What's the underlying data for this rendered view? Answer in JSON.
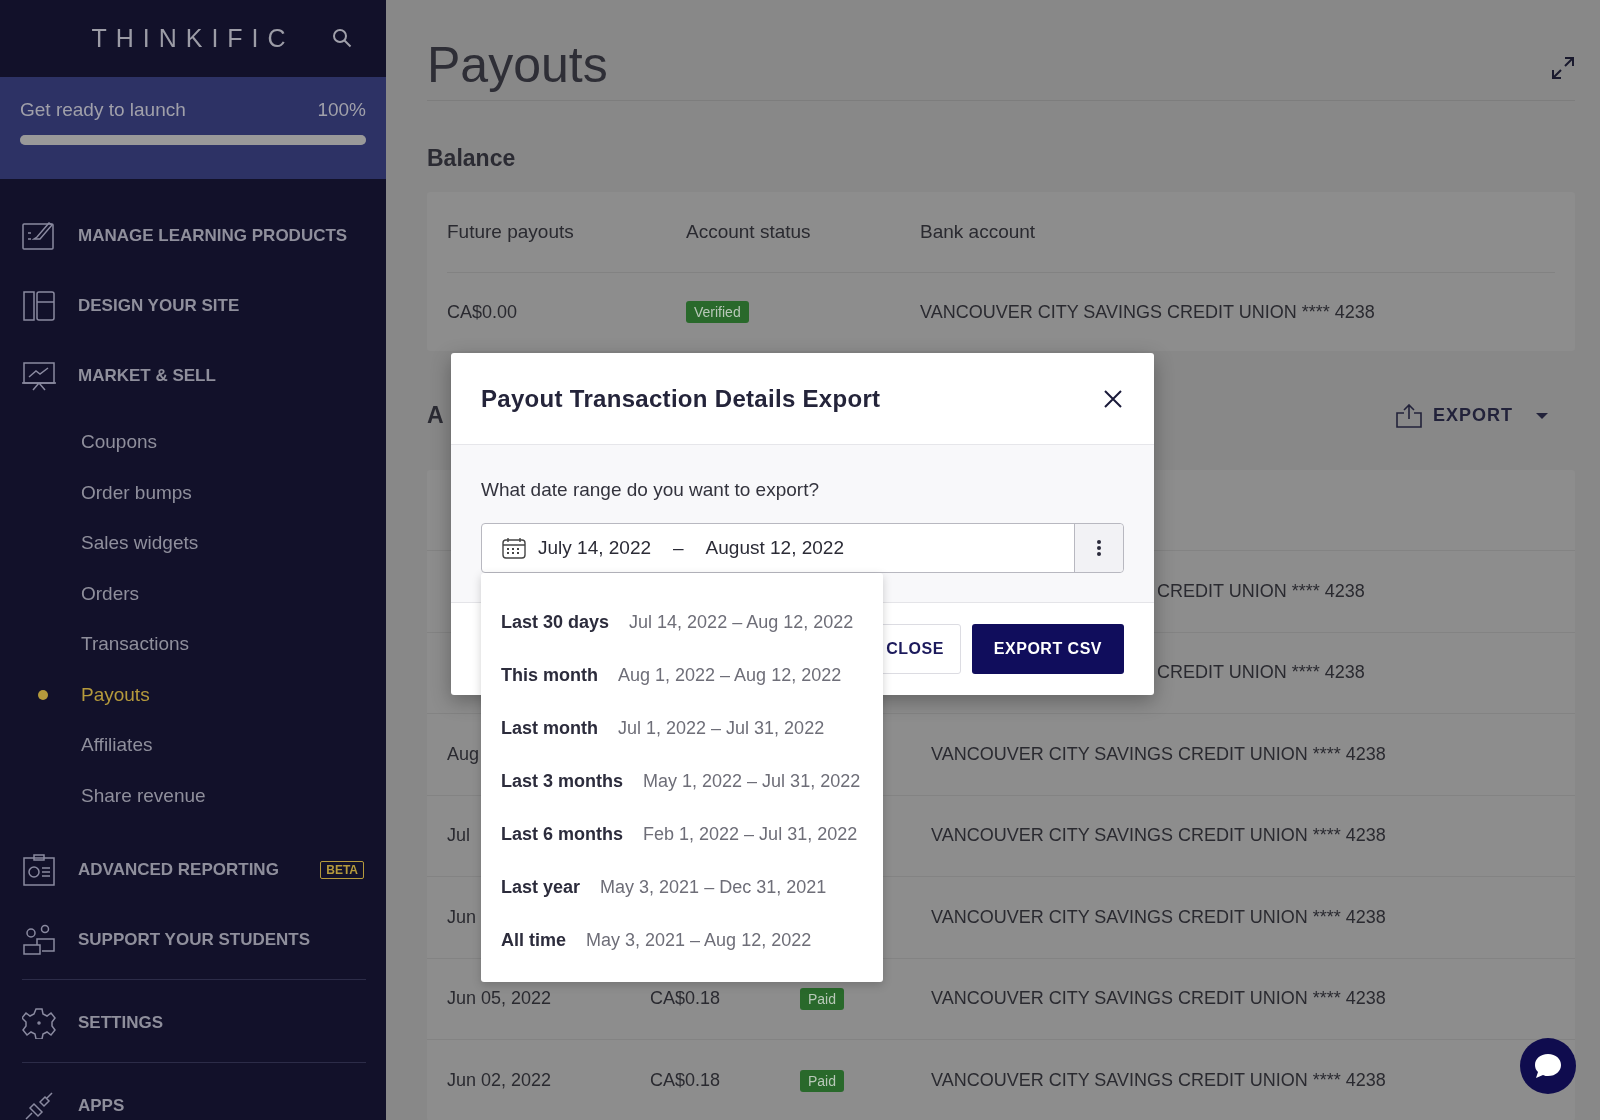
{
  "sidebar": {
    "logo": "THINKIFIC",
    "launch": {
      "label": "Get ready to launch",
      "percent": "100%",
      "level": 1
    },
    "sections": [
      {
        "label": "MANAGE LEARNING PRODUCTS",
        "divider_before": false
      },
      {
        "label": "DESIGN YOUR SITE",
        "divider_before": false
      },
      {
        "label": "MARKET & SELL",
        "divider_before": false,
        "children": [
          {
            "label": "Coupons",
            "selected": false
          },
          {
            "label": "Order bumps",
            "selected": false
          },
          {
            "label": "Sales widgets",
            "selected": false
          },
          {
            "label": "Orders",
            "selected": false
          },
          {
            "label": "Transactions",
            "selected": false
          },
          {
            "label": "Payouts",
            "selected": true
          },
          {
            "label": "Affiliates",
            "selected": false
          },
          {
            "label": "Share revenue",
            "selected": false
          }
        ]
      },
      {
        "label": "ADVANCED REPORTING",
        "badge": "BETA",
        "divider_before": false
      },
      {
        "label": "SUPPORT YOUR STUDENTS",
        "divider_before": false
      },
      {
        "label": "SETTINGS",
        "divider_before": true
      },
      {
        "label": "APPS",
        "divider_before": true
      }
    ]
  },
  "main": {
    "title": "Payouts",
    "balance": {
      "heading": "Balance",
      "columns": [
        "Future payouts",
        "Account status",
        "Bank account"
      ],
      "row": {
        "amount": "CA$0.00",
        "status": "Verified",
        "bank": "VANCOUVER CITY SAVINGS CREDIT UNION **** 4238"
      }
    },
    "activity": {
      "heading": "A",
      "export": "EXPORT",
      "rows": [
        {
          "bank": "CREDIT UNION **** 4238",
          "bank_covered": true
        },
        {
          "bank": "CREDIT UNION **** 4238",
          "bank_covered": true
        },
        {
          "date": "Aug",
          "bank": "VANCOUVER CITY SAVINGS CREDIT UNION **** 4238",
          "bank_covered": false
        },
        {
          "date": "Jul",
          "bank": "VANCOUVER CITY SAVINGS CREDIT UNION **** 4238",
          "bank_covered": false
        },
        {
          "date": "Jun",
          "bank": "VANCOUVER CITY SAVINGS CREDIT UNION **** 4238",
          "bank_covered": false
        },
        {
          "date": "Jun 05, 2022",
          "amount": "CA$0.18",
          "status": "Paid",
          "bank": "VANCOUVER CITY SAVINGS CREDIT UNION **** 4238",
          "bank_covered": false
        },
        {
          "date": "Jun 02, 2022",
          "amount": "CA$0.18",
          "status": "Paid",
          "bank": "VANCOUVER CITY SAVINGS CREDIT UNION **** 4238",
          "bank_covered": false
        }
      ]
    }
  },
  "modal": {
    "title": "Payout Transaction Details Export",
    "question": "What date range do you want to export?",
    "start": "July 14, 2022",
    "separator": "–",
    "end": "August 12, 2022",
    "presets": [
      {
        "label": "Last 30 days",
        "range": "Jul 14, 2022 – Aug 12, 2022"
      },
      {
        "label": "This month",
        "range": "Aug 1, 2022 – Aug 12, 2022"
      },
      {
        "label": "Last month",
        "range": "Jul 1, 2022 – Jul 31, 2022"
      },
      {
        "label": "Last 3 months",
        "range": "May 1, 2022 – Jul 31, 2022"
      },
      {
        "label": "Last 6 months",
        "range": "Feb 1, 2022 – Jul 31, 2022"
      },
      {
        "label": "Last year",
        "range": "May 3, 2021 – Dec 31, 2021"
      },
      {
        "label": "All time",
        "range": "May 3, 2021 – Aug 12, 2022"
      }
    ],
    "close": "CLOSE",
    "export": "EXPORT CSV"
  }
}
